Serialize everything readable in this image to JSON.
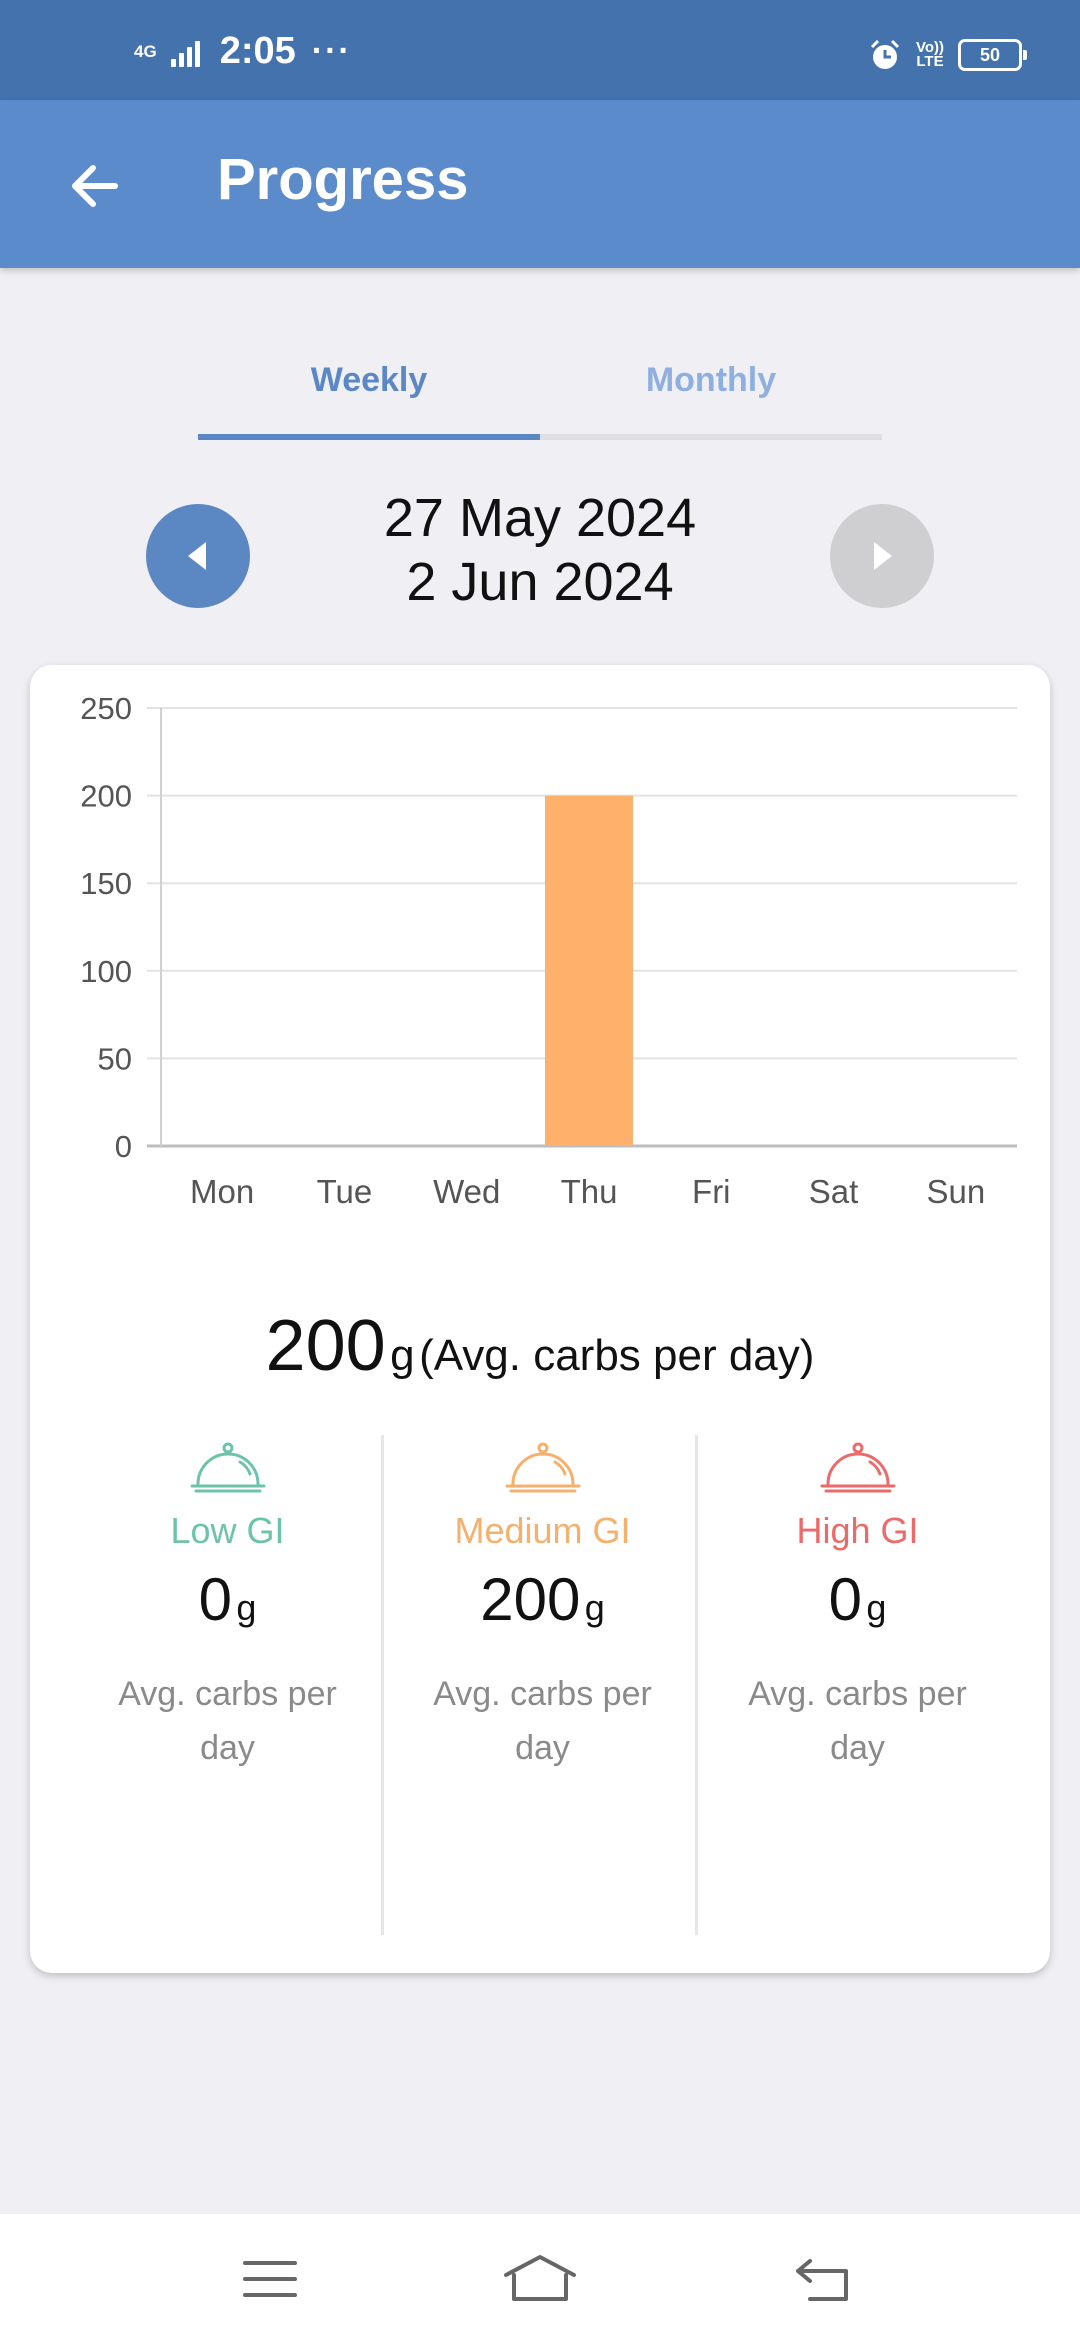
{
  "status_bar": {
    "network": "4G",
    "time": "2:05",
    "dots": "···",
    "volte_top": "Vo))",
    "volte_bottom": "LTE",
    "battery": "50"
  },
  "header": {
    "title": "Progress"
  },
  "tabs": [
    {
      "label": "Weekly",
      "selected": true
    },
    {
      "label": "Monthly",
      "selected": false
    }
  ],
  "date_range": {
    "start": "27 May 2024",
    "end": "2 Jun 2024"
  },
  "chart_data": {
    "type": "bar",
    "categories": [
      "Mon",
      "Tue",
      "Wed",
      "Thu",
      "Fri",
      "Sat",
      "Sun"
    ],
    "values": [
      0,
      0,
      0,
      200,
      0,
      0,
      0
    ],
    "ylim": [
      0,
      250
    ],
    "yticks": [
      "0",
      "50",
      "100",
      "150",
      "200",
      "250"
    ],
    "grid": true,
    "bar_color": "#ffb06a",
    "title": "",
    "xlabel": "",
    "ylabel": ""
  },
  "summary": {
    "value": "200",
    "unit": "g",
    "description": "(Avg. carbs per day)"
  },
  "gi_categories": [
    {
      "label": "Low GI",
      "value": "0",
      "unit": "g",
      "note": "Avg. carbs per day",
      "color": "#6cc3a9",
      "icon": "cloche-icon"
    },
    {
      "label": "Medium GI",
      "value": "200",
      "unit": "g",
      "note": "Avg. carbs per day",
      "color": "#f4b06c",
      "icon": "cloche-icon"
    },
    {
      "label": "High GI",
      "value": "0",
      "unit": "g",
      "note": "Avg. carbs per day",
      "color": "#eb6a6a",
      "icon": "cloche-icon"
    }
  ],
  "colors": {
    "status_bar": "#4372ad",
    "app_bar": "#5b8bca",
    "accent": "#5b87c3",
    "background": "#efeff4"
  }
}
